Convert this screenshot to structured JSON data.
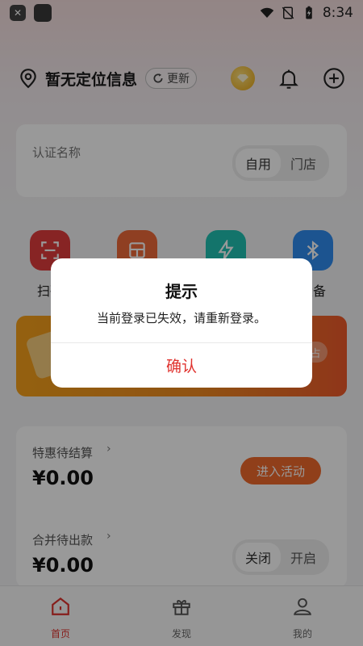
{
  "status_bar": {
    "time": "8:34",
    "icons": [
      "shield-icon",
      "app-icon",
      "wifi-icon",
      "no-sim-icon",
      "battery-icon"
    ]
  },
  "header": {
    "location_text": "暂无定位信息",
    "refresh_label": "更新",
    "icons": [
      "location-pin-icon",
      "refresh-icon",
      "gold-member-icon",
      "bell-icon",
      "plus-circle-icon"
    ]
  },
  "cert_card": {
    "label": "认证名称",
    "segment": {
      "options": [
        "自用",
        "门店"
      ],
      "selected": "自用"
    }
  },
  "quick_actions": [
    {
      "label": "扫码",
      "icon": "scan-icon",
      "color": "#e23c3c"
    },
    {
      "label": "",
      "icon": "store-icon",
      "color": "#ee6a3a"
    },
    {
      "label": "",
      "icon": "lightning-icon",
      "color": "#21c2b2"
    },
    {
      "label": "设备",
      "icon": "bluetooth-icon",
      "color": "#2f8cf0"
    }
  ],
  "banner": {
    "colors": [
      "#f7a21b",
      "#ee5a2b"
    ],
    "tag_text": "占"
  },
  "settlement": {
    "row1": {
      "title": "特惠待结算",
      "amount": "¥0.00",
      "button": "进入活动"
    },
    "row2": {
      "title": "合并待出款",
      "amount": "¥0.00",
      "segment": {
        "options": [
          "关闭",
          "开启"
        ],
        "selected": "关闭"
      }
    }
  },
  "bottom_nav": {
    "items": [
      {
        "label": "首页",
        "icon": "home-icon",
        "active": true
      },
      {
        "label": "发现",
        "icon": "gift-icon",
        "active": false
      },
      {
        "label": "我的",
        "icon": "user-icon",
        "active": false
      }
    ],
    "active_color": "#e0322e"
  },
  "dialog": {
    "title": "提示",
    "message": "当前登录已失效，请重新登录。",
    "confirm_label": "确认",
    "confirm_color": "#e0322e"
  }
}
